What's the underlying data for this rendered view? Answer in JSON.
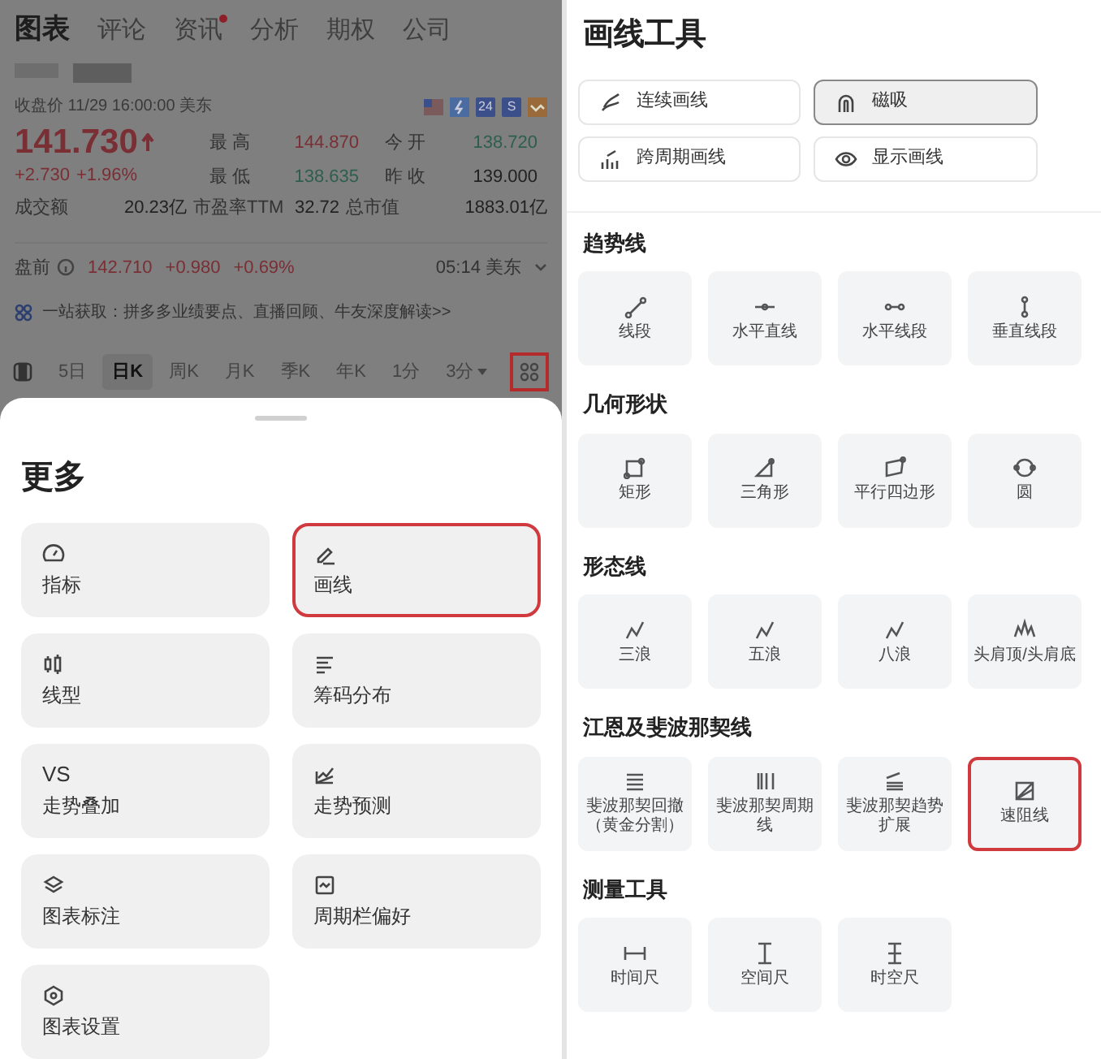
{
  "quote_screen": {
    "tabs": [
      {
        "label": "图表",
        "selected": true,
        "dot": false
      },
      {
        "label": "评论",
        "selected": false,
        "dot": false
      },
      {
        "label": "资讯",
        "selected": false,
        "dot": true
      },
      {
        "label": "分析",
        "selected": false,
        "dot": false
      },
      {
        "label": "期权",
        "selected": false,
        "dot": false
      },
      {
        "label": "公司",
        "selected": false,
        "dot": false
      }
    ],
    "close_label": "收盘价 11/29 16:00:00 美东",
    "badges": [
      {
        "kind": "flag"
      },
      {
        "kind": "bolt"
      },
      {
        "kind": "text",
        "text": "24"
      },
      {
        "kind": "text",
        "text": "S"
      },
      {
        "kind": "trend"
      }
    ],
    "price": "141.730",
    "change": "+2.730",
    "change_pct": "+1.96%",
    "stats": [
      {
        "label": "最 高",
        "value": "144.870",
        "color": "#7a2f35"
      },
      {
        "label": "今 开",
        "value": "138.720",
        "color": "#2e5e4e"
      },
      {
        "label": "最 低",
        "value": "138.635",
        "color": "#2e5e4e"
      },
      {
        "label": "昨 收",
        "value": "139.000",
        "color": "#222222"
      }
    ],
    "stats_row": [
      {
        "label": "成交额",
        "value": "20.23亿"
      },
      {
        "label": "市盈率TTM",
        "value": "32.72"
      },
      {
        "label": "总市值",
        "value": "1883.01亿"
      }
    ],
    "premarket": {
      "label": "盘前",
      "price": "142.710",
      "change": "+0.980",
      "change_pct": "+0.69%",
      "time": "05:14 美东"
    },
    "promo": "一站获取：拼多多业绩要点、直播回顾、牛友深度解读>>",
    "periods": [
      {
        "label": "5日",
        "selected": false
      },
      {
        "label": "日K",
        "selected": true
      },
      {
        "label": "周K",
        "selected": false
      },
      {
        "label": "月K",
        "selected": false
      },
      {
        "label": "季K",
        "selected": false
      },
      {
        "label": "年K",
        "selected": false
      },
      {
        "label": "1分",
        "selected": false
      },
      {
        "label": "3分",
        "selected": false,
        "dropdown": true
      }
    ],
    "more_button": {
      "highlighted": true
    }
  },
  "more_sheet": {
    "title": "更多",
    "items": [
      {
        "label": "指标",
        "highlighted": false
      },
      {
        "label": "画线",
        "highlighted": true
      },
      {
        "label": "线型",
        "highlighted": false
      },
      {
        "label": "筹码分布",
        "highlighted": false
      },
      {
        "label": "走势叠加",
        "icon_text": "VS",
        "highlighted": false
      },
      {
        "label": "走势预测",
        "highlighted": false
      },
      {
        "label": "图表标注",
        "highlighted": false
      },
      {
        "label": "周期栏偏好",
        "highlighted": false
      },
      {
        "label": "图表设置",
        "highlighted": false
      }
    ]
  },
  "drawing_tools": {
    "title": "画线工具",
    "toggles": [
      {
        "label": "连续画线",
        "selected": false
      },
      {
        "label": "磁吸",
        "selected": true
      },
      {
        "label": "跨周期画线",
        "selected": false
      },
      {
        "label": "显示画线",
        "selected": false
      }
    ],
    "sections": [
      {
        "title": "趋势线",
        "tools": [
          {
            "label": "线段",
            "highlighted": false
          },
          {
            "label": "水平直线",
            "highlighted": false
          },
          {
            "label": "水平线段",
            "highlighted": false
          },
          {
            "label": "垂直线段",
            "highlighted": false
          }
        ]
      },
      {
        "title": "几何形状",
        "tools": [
          {
            "label": "矩形",
            "highlighted": false
          },
          {
            "label": "三角形",
            "highlighted": false
          },
          {
            "label": "平行四边形",
            "highlighted": false
          },
          {
            "label": "圆",
            "highlighted": false
          }
        ]
      },
      {
        "title": "形态线",
        "tools": [
          {
            "label": "三浪",
            "highlighted": false
          },
          {
            "label": "五浪",
            "highlighted": false
          },
          {
            "label": "八浪",
            "highlighted": false
          },
          {
            "label": "头肩顶/头肩底",
            "highlighted": false
          }
        ]
      },
      {
        "title": "江恩及斐波那契线",
        "tools": [
          {
            "label": "斐波那契回撤（黄金分割）",
            "highlighted": false
          },
          {
            "label": "斐波那契周期线",
            "highlighted": false
          },
          {
            "label": "斐波那契趋势扩展",
            "highlighted": false
          },
          {
            "label": "速阻线",
            "highlighted": true
          }
        ]
      },
      {
        "title": "测量工具",
        "tools": [
          {
            "label": "时间尺",
            "highlighted": false
          },
          {
            "label": "空间尺",
            "highlighted": false
          },
          {
            "label": "时空尺",
            "highlighted": false
          }
        ]
      }
    ]
  }
}
